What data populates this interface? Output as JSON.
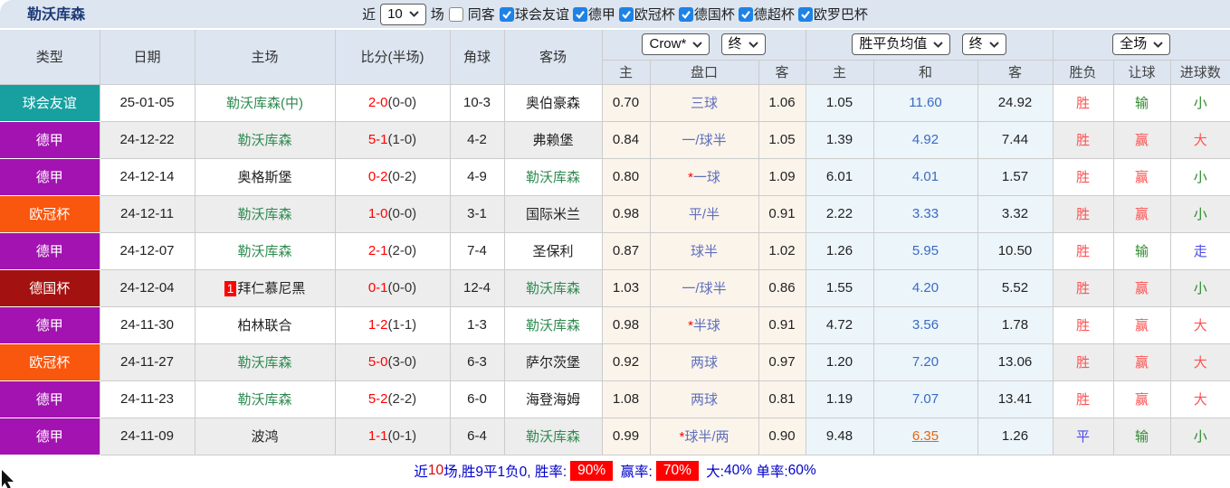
{
  "topbar": {
    "title": "勒沃库森",
    "recent_label": "近",
    "recent_value": "10",
    "games_label": "场",
    "same_venue_label": "同客",
    "same_venue_checked": false,
    "filters": [
      {
        "label": "球会友谊",
        "checked": true
      },
      {
        "label": "德甲",
        "checked": true
      },
      {
        "label": "欧冠杯",
        "checked": true
      },
      {
        "label": "德国杯",
        "checked": true
      },
      {
        "label": "德超杯",
        "checked": true
      },
      {
        "label": "欧罗巴杯",
        "checked": true
      }
    ]
  },
  "table": {
    "main_columns": [
      "类型",
      "日期",
      "主场",
      "比分(半场)",
      "角球",
      "客场"
    ],
    "groups": {
      "handicap": {
        "selects": [
          "Crow*",
          "终"
        ],
        "subcols": [
          "主",
          "盘口",
          "客"
        ]
      },
      "europe": {
        "selects": [
          "胜平负均值",
          "终"
        ],
        "subcols": [
          "主",
          "和",
          "客"
        ]
      },
      "result": {
        "selects": [
          "全场"
        ],
        "subcols": [
          "胜负",
          "让球",
          "进球数"
        ]
      }
    },
    "rows": [
      {
        "league": "球会友谊",
        "date": "25-01-05",
        "home": "勒沃库森(中)",
        "home_is_team": true,
        "home_badge": "",
        "score": "2-0",
        "half_score": "(0-0)",
        "corners": "10-3",
        "away": "奥伯豪森",
        "away_is_team": false,
        "ah_home": "0.70",
        "ah_star": false,
        "ah_line": "三球",
        "ah_away": "1.06",
        "eu_home": "1.05",
        "eu_draw": "11.60",
        "eu_draw_highlight": false,
        "eu_away": "24.92",
        "results": [
          "胜",
          "输",
          "小"
        ],
        "result_colors": [
          "red",
          "green",
          "green"
        ]
      },
      {
        "league": "德甲",
        "date": "24-12-22",
        "home": "勒沃库森",
        "home_is_team": true,
        "home_badge": "",
        "score": "5-1",
        "half_score": "(1-0)",
        "corners": "4-2",
        "away": "弗赖堡",
        "away_is_team": false,
        "ah_home": "0.84",
        "ah_star": false,
        "ah_line": "一/球半",
        "ah_away": "1.05",
        "eu_home": "1.39",
        "eu_draw": "4.92",
        "eu_draw_highlight": false,
        "eu_away": "7.44",
        "results": [
          "胜",
          "赢",
          "大"
        ],
        "result_colors": [
          "red",
          "red",
          "red"
        ]
      },
      {
        "league": "德甲",
        "date": "24-12-14",
        "home": "奥格斯堡",
        "home_is_team": false,
        "home_badge": "",
        "score": "0-2",
        "half_score": "(0-2)",
        "corners": "4-9",
        "away": "勒沃库森",
        "away_is_team": true,
        "ah_home": "0.80",
        "ah_star": true,
        "ah_line": "一球",
        "ah_away": "1.09",
        "eu_home": "6.01",
        "eu_draw": "4.01",
        "eu_draw_highlight": false,
        "eu_away": "1.57",
        "results": [
          "胜",
          "赢",
          "小"
        ],
        "result_colors": [
          "red",
          "red",
          "green"
        ]
      },
      {
        "league": "欧冠杯",
        "date": "24-12-11",
        "home": "勒沃库森",
        "home_is_team": true,
        "home_badge": "",
        "score": "1-0",
        "half_score": "(0-0)",
        "corners": "3-1",
        "away": "国际米兰",
        "away_is_team": false,
        "ah_home": "0.98",
        "ah_star": false,
        "ah_line": "平/半",
        "ah_away": "0.91",
        "eu_home": "2.22",
        "eu_draw": "3.33",
        "eu_draw_highlight": false,
        "eu_away": "3.32",
        "results": [
          "胜",
          "赢",
          "小"
        ],
        "result_colors": [
          "red",
          "red",
          "green"
        ]
      },
      {
        "league": "德甲",
        "date": "24-12-07",
        "home": "勒沃库森",
        "home_is_team": true,
        "home_badge": "",
        "score": "2-1",
        "half_score": "(2-0)",
        "corners": "7-4",
        "away": "圣保利",
        "away_is_team": false,
        "ah_home": "0.87",
        "ah_star": false,
        "ah_line": "球半",
        "ah_away": "1.02",
        "eu_home": "1.26",
        "eu_draw": "5.95",
        "eu_draw_highlight": false,
        "eu_away": "10.50",
        "results": [
          "胜",
          "输",
          "走"
        ],
        "result_colors": [
          "red",
          "green",
          "blue"
        ]
      },
      {
        "league": "德国杯",
        "date": "24-12-04",
        "home": "拜仁慕尼黑",
        "home_is_team": false,
        "home_badge": "1",
        "score": "0-1",
        "half_score": "(0-0)",
        "corners": "12-4",
        "away": "勒沃库森",
        "away_is_team": true,
        "ah_home": "1.03",
        "ah_star": false,
        "ah_line": "一/球半",
        "ah_away": "0.86",
        "eu_home": "1.55",
        "eu_draw": "4.20",
        "eu_draw_highlight": false,
        "eu_away": "5.52",
        "results": [
          "胜",
          "赢",
          "小"
        ],
        "result_colors": [
          "red",
          "red",
          "green"
        ]
      },
      {
        "league": "德甲",
        "date": "24-11-30",
        "home": "柏林联合",
        "home_is_team": false,
        "home_badge": "",
        "score": "1-2",
        "half_score": "(1-1)",
        "corners": "1-3",
        "away": "勒沃库森",
        "away_is_team": true,
        "ah_home": "0.98",
        "ah_star": true,
        "ah_line": "半球",
        "ah_away": "0.91",
        "eu_home": "4.72",
        "eu_draw": "3.56",
        "eu_draw_highlight": false,
        "eu_away": "1.78",
        "results": [
          "胜",
          "赢",
          "大"
        ],
        "result_colors": [
          "red",
          "red",
          "red"
        ]
      },
      {
        "league": "欧冠杯",
        "date": "24-11-27",
        "home": "勒沃库森",
        "home_is_team": true,
        "home_badge": "",
        "score": "5-0",
        "half_score": "(3-0)",
        "corners": "6-3",
        "away": "萨尔茨堡",
        "away_is_team": false,
        "ah_home": "0.92",
        "ah_star": false,
        "ah_line": "两球",
        "ah_away": "0.97",
        "eu_home": "1.20",
        "eu_draw": "7.20",
        "eu_draw_highlight": false,
        "eu_away": "13.06",
        "results": [
          "胜",
          "赢",
          "大"
        ],
        "result_colors": [
          "red",
          "red",
          "red"
        ]
      },
      {
        "league": "德甲",
        "date": "24-11-23",
        "home": "勒沃库森",
        "home_is_team": true,
        "home_badge": "",
        "score": "5-2",
        "half_score": "(2-2)",
        "corners": "6-0",
        "away": "海登海姆",
        "away_is_team": false,
        "ah_home": "1.08",
        "ah_star": false,
        "ah_line": "两球",
        "ah_away": "0.81",
        "eu_home": "1.19",
        "eu_draw": "7.07",
        "eu_draw_highlight": false,
        "eu_away": "13.41",
        "results": [
          "胜",
          "赢",
          "大"
        ],
        "result_colors": [
          "red",
          "red",
          "red"
        ]
      },
      {
        "league": "德甲",
        "date": "24-11-09",
        "home": "波鸿",
        "home_is_team": false,
        "home_badge": "",
        "score": "1-1",
        "half_score": "(0-1)",
        "corners": "6-4",
        "away": "勒沃库森",
        "away_is_team": true,
        "ah_home": "0.99",
        "ah_star": true,
        "ah_line": "球半/两",
        "ah_away": "0.90",
        "eu_home": "9.48",
        "eu_draw": "6.35",
        "eu_draw_highlight": true,
        "eu_away": "1.26",
        "results": [
          "平",
          "输",
          "小"
        ],
        "result_colors": [
          "blue",
          "green",
          "green"
        ]
      }
    ]
  },
  "summary": {
    "segments": [
      {
        "text": "近",
        "style": "blue"
      },
      {
        "text": "10",
        "style": "red"
      },
      {
        "text": "场,胜9平1负0, 胜率:",
        "style": "blue"
      },
      {
        "text": "90%",
        "style": "badge"
      },
      {
        "text": " 赢率:",
        "style": "blue"
      },
      {
        "text": "70%",
        "style": "badge"
      },
      {
        "text": " 大:",
        "style": "blue"
      },
      {
        "text": "40%",
        "style": "blue"
      },
      {
        "text": " 单率:",
        "style": "blue"
      },
      {
        "text": "60%",
        "style": "blue"
      }
    ]
  },
  "colors": {
    "leagues": {
      "球会友谊": "#18a0a0",
      "德甲": "#a313b1",
      "欧冠杯": "#f9560e",
      "德国杯": "#a31210"
    },
    "results": {
      "red": "#ff5252",
      "green": "#2e8b2e",
      "blue": "#4a4ae8"
    },
    "accent_blue": "#0000cc",
    "accent_red": "#ff0000",
    "checkbox_blue": "#1e82e6"
  }
}
